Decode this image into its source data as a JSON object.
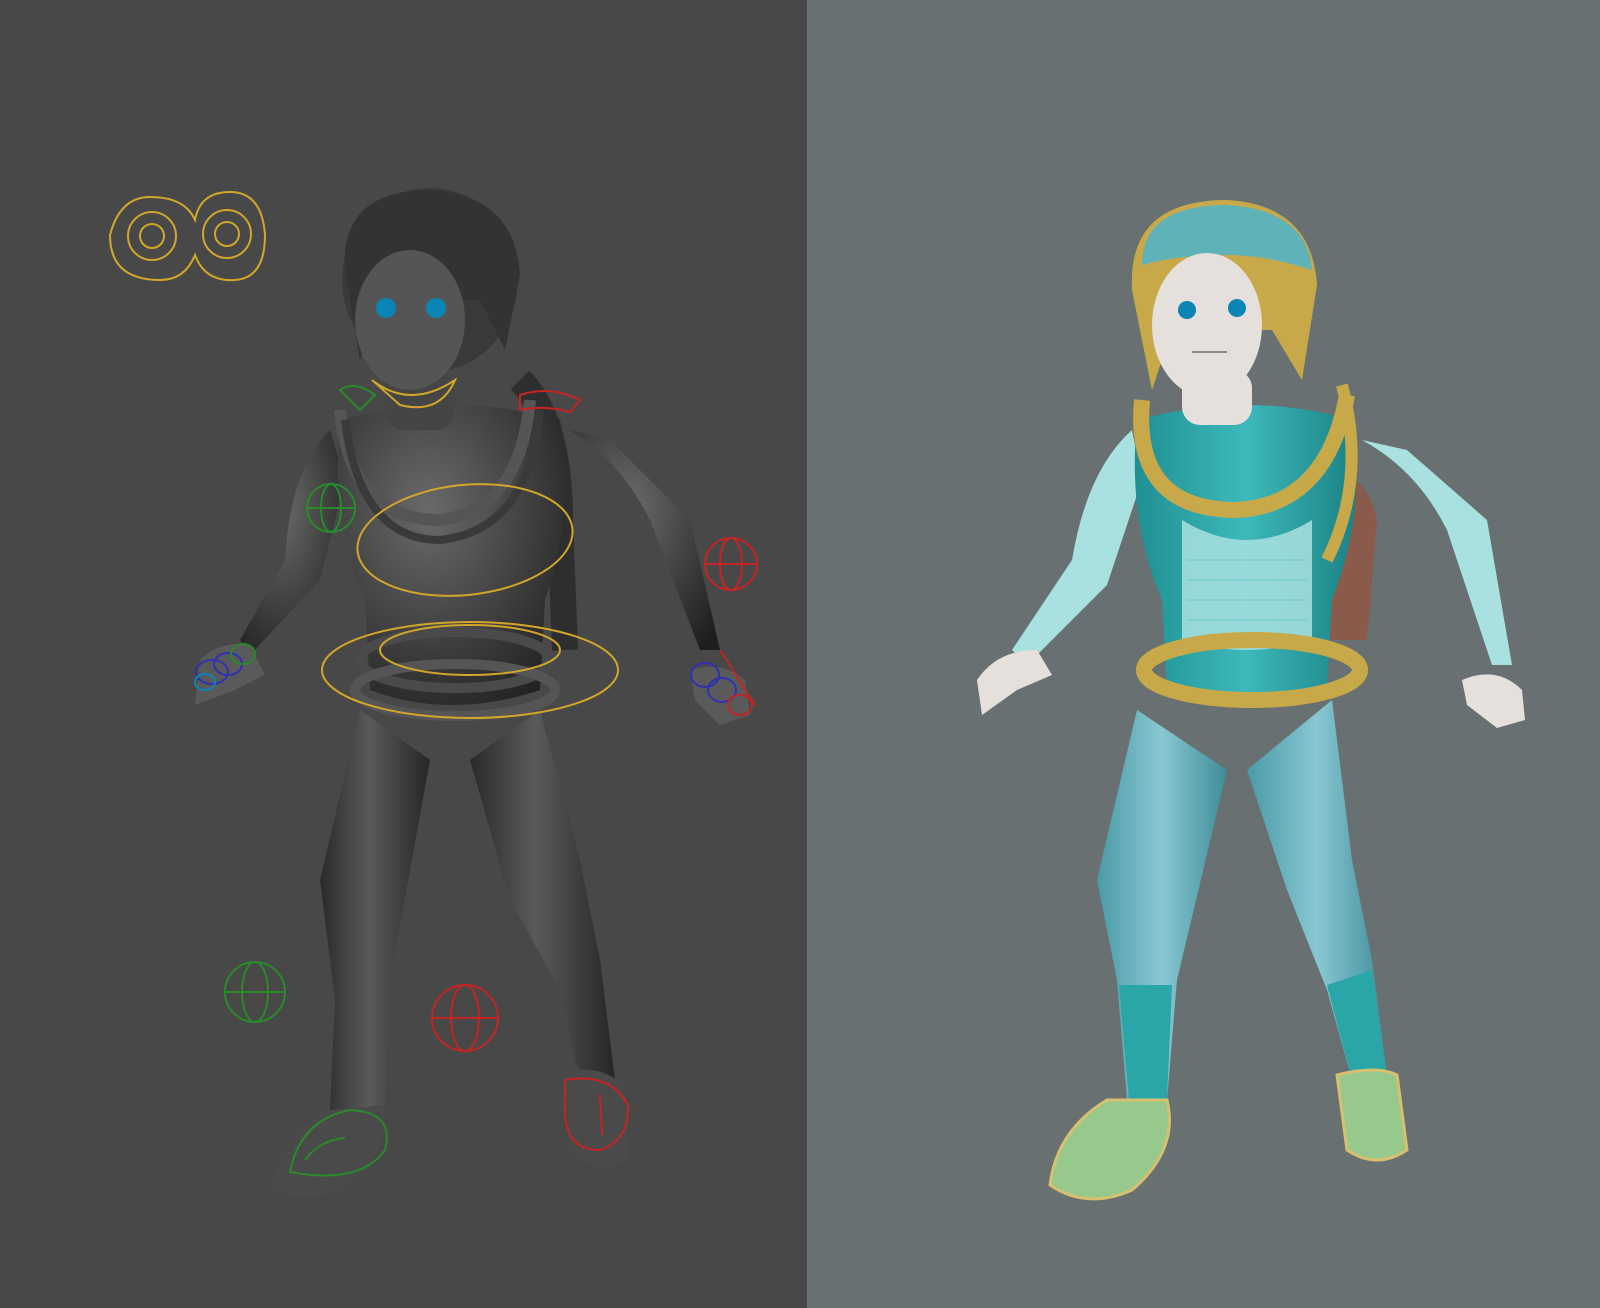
{
  "viewports": {
    "left": {
      "shading": "solid",
      "background": "#484848",
      "model_color": "#3a3a3a"
    },
    "right": {
      "shading": "material-preview",
      "background": "#687071"
    }
  },
  "rig_colors": {
    "center": "#d2a62a",
    "left": "#2a8a2a",
    "right": "#c42424",
    "fingers": "#3030b0"
  },
  "character_colors": {
    "suit": "#2aa6a8",
    "suit_light": "#a9e0e0",
    "trousers": "#6fb9c6",
    "rope": "#c8a94a",
    "skin": "#e6e0dc",
    "eyes": "#0b84b6",
    "shoes": "#98c98c",
    "backpack": "#8a5a4a"
  },
  "icons": [
    "eye-controller-icon",
    "master-torso-controller-icon",
    "hip-controller-icon",
    "ik-pole-icon",
    "foot-ik-icon",
    "finger-controllers-icon"
  ]
}
